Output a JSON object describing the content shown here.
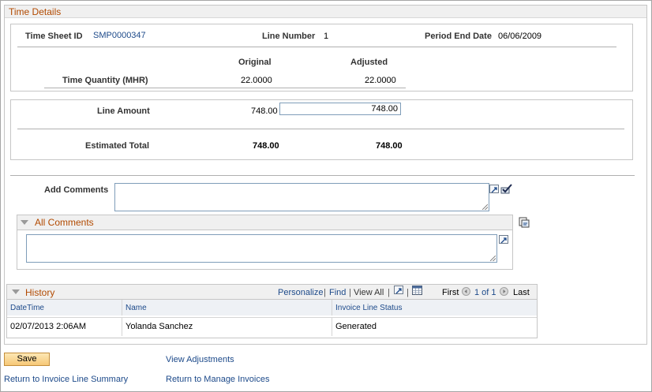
{
  "time_details": {
    "title": "Time Details",
    "time_sheet_id_label": "Time Sheet ID",
    "time_sheet_id": "SMP0000347",
    "line_number_label": "Line Number",
    "line_number": "1",
    "period_end_date_label": "Period End Date",
    "period_end_date": "06/06/2009",
    "original_header": "Original",
    "adjusted_header": "Adjusted",
    "time_quantity_label": "Time Quantity (MHR)",
    "time_quantity_original": "22.0000",
    "time_quantity_adjusted": "22.0000",
    "line_amount_label": "Line Amount",
    "line_amount_original": "748.00",
    "line_amount_adjusted": "748.00",
    "estimated_total_label": "Estimated Total",
    "estimated_total_original": "748.00",
    "estimated_total_adjusted": "748.00",
    "add_comments_label": "Add Comments",
    "add_comments_value": "",
    "all_comments_title": "All Comments",
    "all_comments_value": ""
  },
  "history": {
    "title": "History",
    "personalize": "Personalize",
    "find": "Find",
    "view_all": "View All",
    "first": "First",
    "range": "1 of 1",
    "last": "Last",
    "columns": [
      "DateTime",
      "Name",
      "Invoice Line Status"
    ],
    "rows": [
      [
        "02/07/2013  2:06AM",
        "Yolanda Sanchez",
        "Generated"
      ]
    ]
  },
  "footer": {
    "save": "Save",
    "view_adjustments": "View Adjustments",
    "return_invoice_line_summary": "Return to Invoice Line Summary",
    "return_manage_invoices": "Return to Manage Invoices"
  },
  "colors": {
    "section_title": "#b24a00",
    "link": "#1d4a8a",
    "save_button": "#f6c877"
  }
}
